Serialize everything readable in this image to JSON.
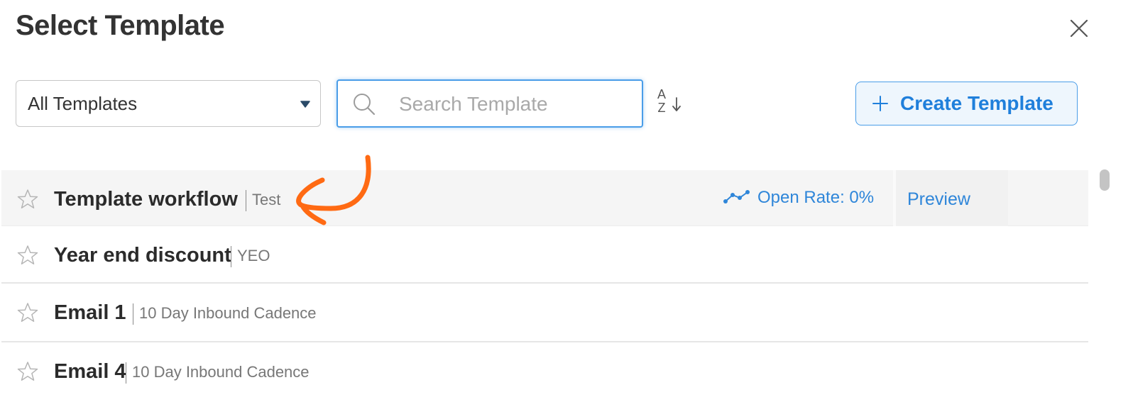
{
  "dialog": {
    "title": "Select Template",
    "close_icon": "close-icon"
  },
  "toolbar": {
    "folder_select": {
      "value": "All Templates",
      "icon": "caret-down-icon"
    },
    "search": {
      "placeholder": "Search Template",
      "value": "",
      "icon": "search-icon"
    },
    "sort": {
      "letters_top": "A",
      "letters_bottom": "Z",
      "icon": "sort-alpha-down-icon"
    },
    "create_button": {
      "label": "Create Template",
      "icon": "plus-icon"
    }
  },
  "templates": [
    {
      "name": "Template workflow",
      "folder": "Test",
      "open_rate": "Open Rate: 0%",
      "preview": "Preview",
      "hovered": true
    },
    {
      "name": "Year end discount",
      "folder": "YEO"
    },
    {
      "name": "Email 1",
      "folder": "10 Day Inbound Cadence"
    },
    {
      "name": "Email 4",
      "folder": "10 Day Inbound Cadence"
    }
  ],
  "colors": {
    "accent": "#2f86d9",
    "search_focus": "#4a9de8",
    "annotation": "#ff6a13",
    "hover_row": "#f5f5f5"
  }
}
